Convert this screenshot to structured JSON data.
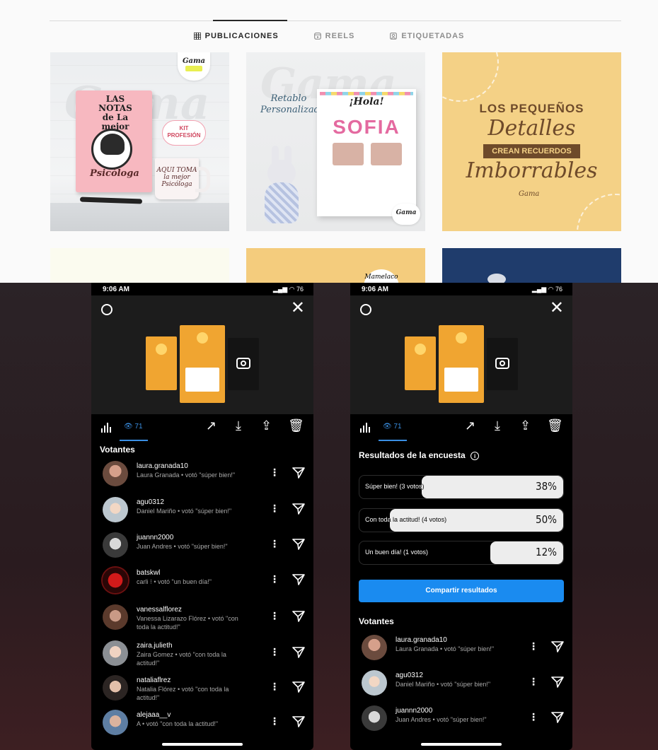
{
  "profile": {
    "tabs": [
      {
        "label": "PUBLICACIONES",
        "icon": "grid-icon",
        "active": true
      },
      {
        "label": "REELS",
        "icon": "reels-icon",
        "active": false
      },
      {
        "label": "ETIQUETADAS",
        "icon": "tagged-icon",
        "active": false
      }
    ],
    "posts": [
      {
        "brand": "Gama",
        "book_title": "LAS NOTAS de La mejor",
        "kit_label": "KIT PROFESIÓN",
        "book_caption": "Psicóloga",
        "mug_text": "AQUI TOMA la mejor Psicóloga"
      },
      {
        "ghost": "Gama",
        "title": "Retablo Personalizado",
        "greeting": "¡Hola!",
        "name": "SOFIA",
        "brand": "Gama"
      },
      {
        "line1": "LOS PEQUEÑOS",
        "line2": "Detalles",
        "ribbon": "CREAN RECUERDOS",
        "line3": "Imborrables",
        "brand": "Gama"
      }
    ],
    "row2": {
      "badge": "Mamelaco"
    }
  },
  "phones": {
    "status": {
      "time": "9:06 AM",
      "battery": "76"
    },
    "views_count": "71",
    "left": {
      "section_title": "Votantes",
      "voters": [
        {
          "username": "laura.granada10",
          "desc": "Laura Granada • votó \"súper bien!\""
        },
        {
          "username": "agu0312",
          "desc": "Daniel Mariño • votó \"súper bien!\""
        },
        {
          "username": "juannn2000",
          "desc": "Juan Andres • votó \"súper bien!\""
        },
        {
          "username": "batskwl",
          "desc": "carli ⁝ • votó \"un buen día!\""
        },
        {
          "username": "vanessalflorez",
          "desc": "Vanessa Lizarazo Flórez • votó \"con toda la actitud!\""
        },
        {
          "username": "zaira.julieth",
          "desc": "Zaira Gomez • votó \"con toda la actitud!\""
        },
        {
          "username": "nataliaflrez",
          "desc": "Natalia Flórez • votó \"con toda la actitud!\""
        },
        {
          "username": "alejaaa__v",
          "desc": "A • votó \"con toda la actitud!\""
        }
      ]
    },
    "right": {
      "results_title": "Resultados de la encuesta",
      "options": [
        {
          "label": "Súper bien! (3 votos)",
          "percent_label": "38%",
          "percent": 38
        },
        {
          "label": "Con toda la actitud! (4 votos)",
          "percent_label": "50%",
          "percent": 50
        },
        {
          "label": "Un buen día! (1 votos)",
          "percent_label": "12%",
          "percent": 12
        }
      ],
      "share_label": "Compartir resultados",
      "section_title": "Votantes",
      "voters": [
        {
          "username": "laura.granada10",
          "desc": "Laura Granada • votó \"súper bien!\""
        },
        {
          "username": "agu0312",
          "desc": "Daniel Mariño • votó \"súper bien!\""
        },
        {
          "username": "juannn2000",
          "desc": "Juan Andres • votó \"súper bien!\""
        }
      ]
    }
  },
  "colors": {
    "accent_blue": "#1a8bf0",
    "story_orange": "#f0a531",
    "post3_bg": "#f4d186"
  }
}
